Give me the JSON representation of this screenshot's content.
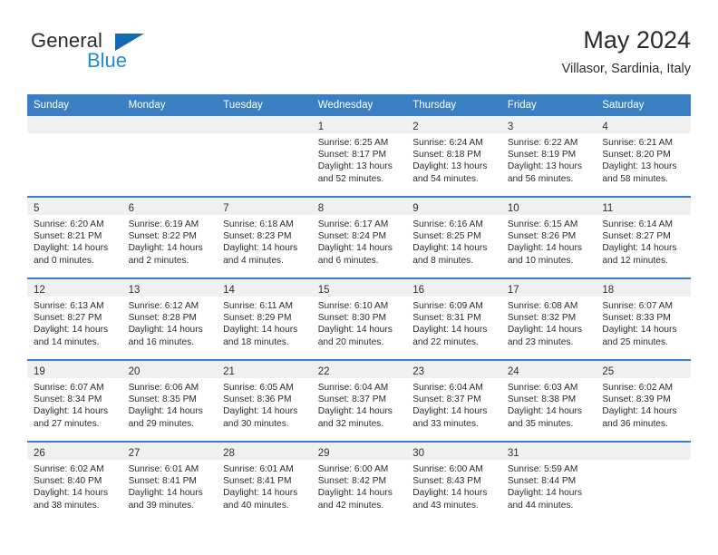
{
  "brand": {
    "name_part1": "General",
    "name_part2": "Blue",
    "logo_icon": "blue-triangle-logo",
    "color_dark": "#2b2b2b",
    "color_blue": "#1f8ad6",
    "triangle_color": "#1268b3"
  },
  "header": {
    "title": "May 2024",
    "subtitle": "Villasor, Sardinia, Italy"
  },
  "theme": {
    "header_bg": "#3a7fc1",
    "header_text": "#ffffff",
    "daynum_band_bg": "#f0f0f0",
    "row_divider": "#3a7fc1",
    "body_text": "#2b2b2b"
  },
  "weekday_headers": [
    "Sunday",
    "Monday",
    "Tuesday",
    "Wednesday",
    "Thursday",
    "Friday",
    "Saturday"
  ],
  "weeks": [
    [
      {
        "day": "",
        "sunrise": "",
        "sunset": "",
        "daylight_line1": "",
        "daylight_line2": ""
      },
      {
        "day": "",
        "sunrise": "",
        "sunset": "",
        "daylight_line1": "",
        "daylight_line2": ""
      },
      {
        "day": "",
        "sunrise": "",
        "sunset": "",
        "daylight_line1": "",
        "daylight_line2": ""
      },
      {
        "day": "1",
        "sunrise": "Sunrise: 6:25 AM",
        "sunset": "Sunset: 8:17 PM",
        "daylight_line1": "Daylight: 13 hours",
        "daylight_line2": "and 52 minutes."
      },
      {
        "day": "2",
        "sunrise": "Sunrise: 6:24 AM",
        "sunset": "Sunset: 8:18 PM",
        "daylight_line1": "Daylight: 13 hours",
        "daylight_line2": "and 54 minutes."
      },
      {
        "day": "3",
        "sunrise": "Sunrise: 6:22 AM",
        "sunset": "Sunset: 8:19 PM",
        "daylight_line1": "Daylight: 13 hours",
        "daylight_line2": "and 56 minutes."
      },
      {
        "day": "4",
        "sunrise": "Sunrise: 6:21 AM",
        "sunset": "Sunset: 8:20 PM",
        "daylight_line1": "Daylight: 13 hours",
        "daylight_line2": "and 58 minutes."
      }
    ],
    [
      {
        "day": "5",
        "sunrise": "Sunrise: 6:20 AM",
        "sunset": "Sunset: 8:21 PM",
        "daylight_line1": "Daylight: 14 hours",
        "daylight_line2": "and 0 minutes."
      },
      {
        "day": "6",
        "sunrise": "Sunrise: 6:19 AM",
        "sunset": "Sunset: 8:22 PM",
        "daylight_line1": "Daylight: 14 hours",
        "daylight_line2": "and 2 minutes."
      },
      {
        "day": "7",
        "sunrise": "Sunrise: 6:18 AM",
        "sunset": "Sunset: 8:23 PM",
        "daylight_line1": "Daylight: 14 hours",
        "daylight_line2": "and 4 minutes."
      },
      {
        "day": "8",
        "sunrise": "Sunrise: 6:17 AM",
        "sunset": "Sunset: 8:24 PM",
        "daylight_line1": "Daylight: 14 hours",
        "daylight_line2": "and 6 minutes."
      },
      {
        "day": "9",
        "sunrise": "Sunrise: 6:16 AM",
        "sunset": "Sunset: 8:25 PM",
        "daylight_line1": "Daylight: 14 hours",
        "daylight_line2": "and 8 minutes."
      },
      {
        "day": "10",
        "sunrise": "Sunrise: 6:15 AM",
        "sunset": "Sunset: 8:26 PM",
        "daylight_line1": "Daylight: 14 hours",
        "daylight_line2": "and 10 minutes."
      },
      {
        "day": "11",
        "sunrise": "Sunrise: 6:14 AM",
        "sunset": "Sunset: 8:27 PM",
        "daylight_line1": "Daylight: 14 hours",
        "daylight_line2": "and 12 minutes."
      }
    ],
    [
      {
        "day": "12",
        "sunrise": "Sunrise: 6:13 AM",
        "sunset": "Sunset: 8:27 PM",
        "daylight_line1": "Daylight: 14 hours",
        "daylight_line2": "and 14 minutes."
      },
      {
        "day": "13",
        "sunrise": "Sunrise: 6:12 AM",
        "sunset": "Sunset: 8:28 PM",
        "daylight_line1": "Daylight: 14 hours",
        "daylight_line2": "and 16 minutes."
      },
      {
        "day": "14",
        "sunrise": "Sunrise: 6:11 AM",
        "sunset": "Sunset: 8:29 PM",
        "daylight_line1": "Daylight: 14 hours",
        "daylight_line2": "and 18 minutes."
      },
      {
        "day": "15",
        "sunrise": "Sunrise: 6:10 AM",
        "sunset": "Sunset: 8:30 PM",
        "daylight_line1": "Daylight: 14 hours",
        "daylight_line2": "and 20 minutes."
      },
      {
        "day": "16",
        "sunrise": "Sunrise: 6:09 AM",
        "sunset": "Sunset: 8:31 PM",
        "daylight_line1": "Daylight: 14 hours",
        "daylight_line2": "and 22 minutes."
      },
      {
        "day": "17",
        "sunrise": "Sunrise: 6:08 AM",
        "sunset": "Sunset: 8:32 PM",
        "daylight_line1": "Daylight: 14 hours",
        "daylight_line2": "and 23 minutes."
      },
      {
        "day": "18",
        "sunrise": "Sunrise: 6:07 AM",
        "sunset": "Sunset: 8:33 PM",
        "daylight_line1": "Daylight: 14 hours",
        "daylight_line2": "and 25 minutes."
      }
    ],
    [
      {
        "day": "19",
        "sunrise": "Sunrise: 6:07 AM",
        "sunset": "Sunset: 8:34 PM",
        "daylight_line1": "Daylight: 14 hours",
        "daylight_line2": "and 27 minutes."
      },
      {
        "day": "20",
        "sunrise": "Sunrise: 6:06 AM",
        "sunset": "Sunset: 8:35 PM",
        "daylight_line1": "Daylight: 14 hours",
        "daylight_line2": "and 29 minutes."
      },
      {
        "day": "21",
        "sunrise": "Sunrise: 6:05 AM",
        "sunset": "Sunset: 8:36 PM",
        "daylight_line1": "Daylight: 14 hours",
        "daylight_line2": "and 30 minutes."
      },
      {
        "day": "22",
        "sunrise": "Sunrise: 6:04 AM",
        "sunset": "Sunset: 8:37 PM",
        "daylight_line1": "Daylight: 14 hours",
        "daylight_line2": "and 32 minutes."
      },
      {
        "day": "23",
        "sunrise": "Sunrise: 6:04 AM",
        "sunset": "Sunset: 8:37 PM",
        "daylight_line1": "Daylight: 14 hours",
        "daylight_line2": "and 33 minutes."
      },
      {
        "day": "24",
        "sunrise": "Sunrise: 6:03 AM",
        "sunset": "Sunset: 8:38 PM",
        "daylight_line1": "Daylight: 14 hours",
        "daylight_line2": "and 35 minutes."
      },
      {
        "day": "25",
        "sunrise": "Sunrise: 6:02 AM",
        "sunset": "Sunset: 8:39 PM",
        "daylight_line1": "Daylight: 14 hours",
        "daylight_line2": "and 36 minutes."
      }
    ],
    [
      {
        "day": "26",
        "sunrise": "Sunrise: 6:02 AM",
        "sunset": "Sunset: 8:40 PM",
        "daylight_line1": "Daylight: 14 hours",
        "daylight_line2": "and 38 minutes."
      },
      {
        "day": "27",
        "sunrise": "Sunrise: 6:01 AM",
        "sunset": "Sunset: 8:41 PM",
        "daylight_line1": "Daylight: 14 hours",
        "daylight_line2": "and 39 minutes."
      },
      {
        "day": "28",
        "sunrise": "Sunrise: 6:01 AM",
        "sunset": "Sunset: 8:41 PM",
        "daylight_line1": "Daylight: 14 hours",
        "daylight_line2": "and 40 minutes."
      },
      {
        "day": "29",
        "sunrise": "Sunrise: 6:00 AM",
        "sunset": "Sunset: 8:42 PM",
        "daylight_line1": "Daylight: 14 hours",
        "daylight_line2": "and 42 minutes."
      },
      {
        "day": "30",
        "sunrise": "Sunrise: 6:00 AM",
        "sunset": "Sunset: 8:43 PM",
        "daylight_line1": "Daylight: 14 hours",
        "daylight_line2": "and 43 minutes."
      },
      {
        "day": "31",
        "sunrise": "Sunrise: 5:59 AM",
        "sunset": "Sunset: 8:44 PM",
        "daylight_line1": "Daylight: 14 hours",
        "daylight_line2": "and 44 minutes."
      },
      {
        "day": "",
        "sunrise": "",
        "sunset": "",
        "daylight_line1": "",
        "daylight_line2": ""
      }
    ]
  ]
}
